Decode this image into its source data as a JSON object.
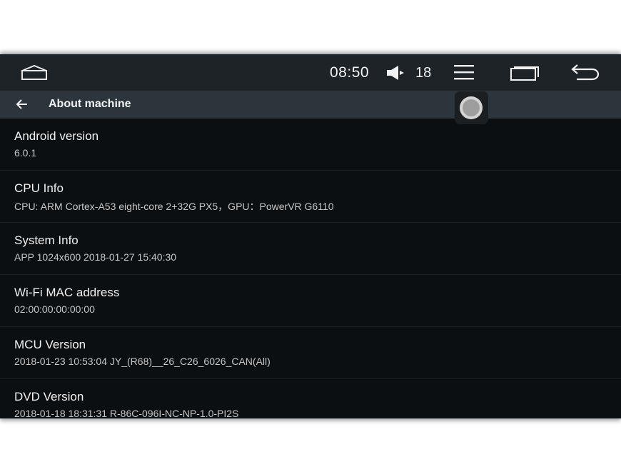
{
  "status_bar": {
    "time": "08:50",
    "volume_level": "18",
    "icons": [
      "home-icon",
      "volume-icon",
      "menu-icon",
      "recents-icon",
      "back-icon"
    ]
  },
  "app_bar": {
    "title": "About machine",
    "icons": [
      "back-arrow-icon",
      "assistive-touch-icon"
    ]
  },
  "items": [
    {
      "title": "Android version",
      "value": "6.0.1"
    },
    {
      "title": "CPU Info",
      "value": "CPU: ARM Cortex-A53 eight-core 2+32G PX5，GPU：PowerVR G6110"
    },
    {
      "title": "System Info",
      "value": "APP 1024x600 2018-01-27 15:40:30"
    },
    {
      "title": "Wi-Fi MAC address",
      "value": "02:00:00:00:00:00"
    },
    {
      "title": "MCU Version",
      "value": "2018-01-23 10:53:04 JY_(R68)__26_C26_6026_CAN(All)"
    },
    {
      "title": "DVD Version",
      "value": "2018-01-18 18:31:31 R-86C-096I-NC-NP-1.0-PI2S"
    }
  ],
  "colors": {
    "background": "#0c0f12",
    "status_bar": "#1e2327",
    "app_bar": "#2c353b",
    "text_primary": "#f1f1f1",
    "text_secondary": "#c6c6c6"
  }
}
